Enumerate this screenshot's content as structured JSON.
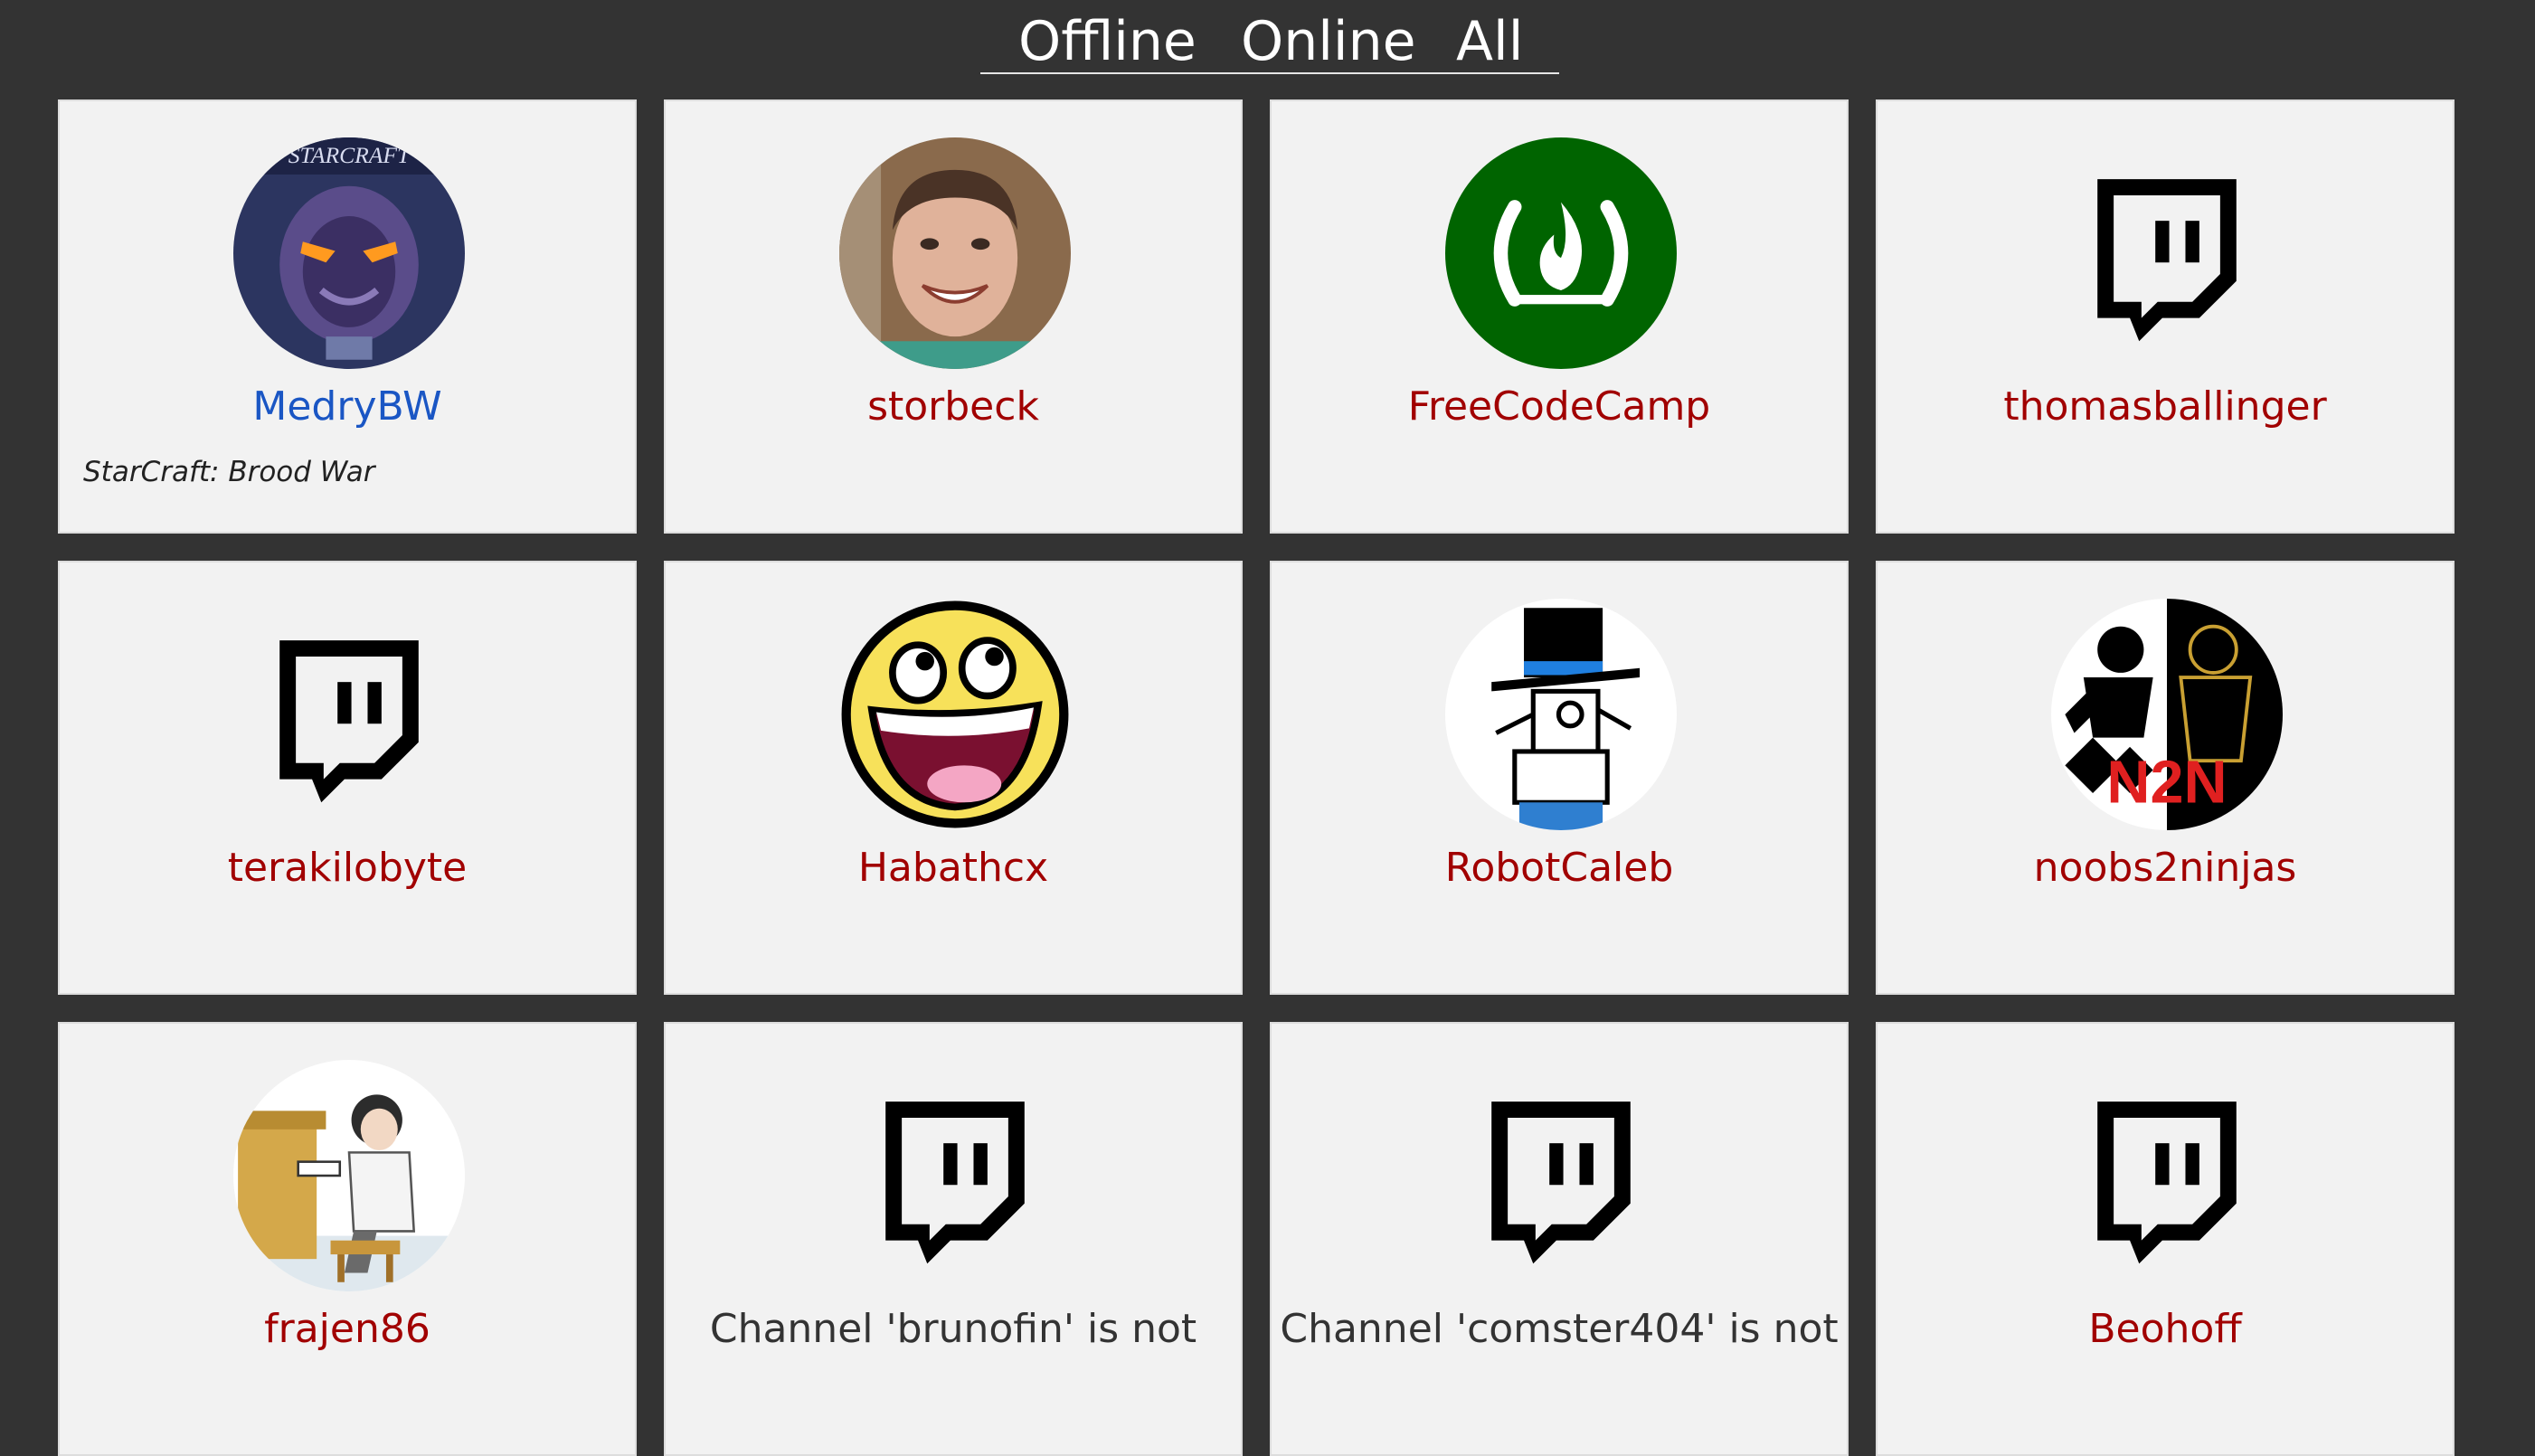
{
  "filters": [
    {
      "label": "Offline"
    },
    {
      "label": "Online"
    },
    {
      "label": "All"
    }
  ],
  "colors": {
    "background": "#333333",
    "card": "#f2f2f2",
    "online_name": "#1a56c4",
    "offline_name": "#a10000"
  },
  "channels": [
    {
      "name": "MedryBW",
      "status": "online",
      "game": "StarCraft: Brood War",
      "icon": "starcraft-avatar"
    },
    {
      "name": "storbeck",
      "status": "offline",
      "icon": "person-photo-avatar"
    },
    {
      "name": "FreeCodeCamp",
      "status": "offline",
      "icon": "freecodecamp-logo"
    },
    {
      "name": "thomasballinger",
      "status": "offline",
      "icon": "twitch-glitch-icon"
    },
    {
      "name": "terakilobyte",
      "status": "offline",
      "icon": "twitch-glitch-icon"
    },
    {
      "name": "Habathcx",
      "status": "offline",
      "icon": "smiley-face-avatar"
    },
    {
      "name": "RobotCaleb",
      "status": "offline",
      "icon": "robot-top-hat-avatar"
    },
    {
      "name": "noobs2ninjas",
      "status": "offline",
      "icon": "noobs2ninjas-logo"
    },
    {
      "name": "frajen86",
      "status": "offline",
      "icon": "piano-player-avatar"
    },
    {
      "name": "Channel 'brunofin' is not",
      "status": "error",
      "icon": "twitch-glitch-icon"
    },
    {
      "name": "Channel 'comster404' is not",
      "status": "error",
      "icon": "twitch-glitch-icon"
    },
    {
      "name": "Beohoff",
      "status": "offline",
      "icon": "twitch-glitch-icon"
    }
  ]
}
